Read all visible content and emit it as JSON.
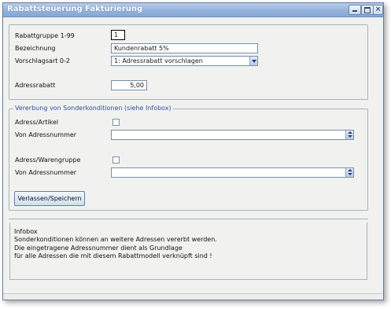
{
  "window": {
    "title": "Rabattsteuerung Fakturierung"
  },
  "form": {
    "rabattgruppe": {
      "label": "Rabattgruppe 1-99",
      "value": "1"
    },
    "bezeichnung": {
      "label": "Bezeichnung",
      "value": "Kundenrabatt 5%"
    },
    "vorschlagsart": {
      "label": "Vorschlagsart 0-2",
      "value": "1: Adressrabatt vorschlagen"
    },
    "adressrabatt": {
      "label": "Adressrabatt",
      "value": "5,00"
    }
  },
  "inheritance": {
    "legend": "Vererbung von Sonderkonditionen (siehe Infobox)",
    "adress_artikel": {
      "label": "Adress/Artikel",
      "checked": false
    },
    "von_adressnummer_1": {
      "label": "Von Adressnummer",
      "value": ""
    },
    "adress_warengruppe": {
      "label": "Adress/Warengruppe",
      "checked": false
    },
    "von_adressnummer_2": {
      "label": "Von Adressnummer",
      "value": ""
    }
  },
  "actions": {
    "save_label": "Verlassen/Speichern"
  },
  "infobox": {
    "title": "Infobox",
    "lines": [
      "Sonderkonditionen können an weitere Adressen vererbt werden.",
      "Die eingetragene Adressnummer dient als Grundlage",
      "für alle Adressen die mit diesem Rabattmodell verknüpft sind !"
    ]
  },
  "colors": {
    "titlebar": "#93b2db",
    "legend_text": "#2d4fa8",
    "window_bg": "#f1f2ef"
  },
  "icons": {
    "minimize": "minimize-icon",
    "maximize": "maximize-icon",
    "close": "close-icon",
    "dropdown": "chevron-down-icon",
    "spinner": "up-down-arrows-icon"
  }
}
